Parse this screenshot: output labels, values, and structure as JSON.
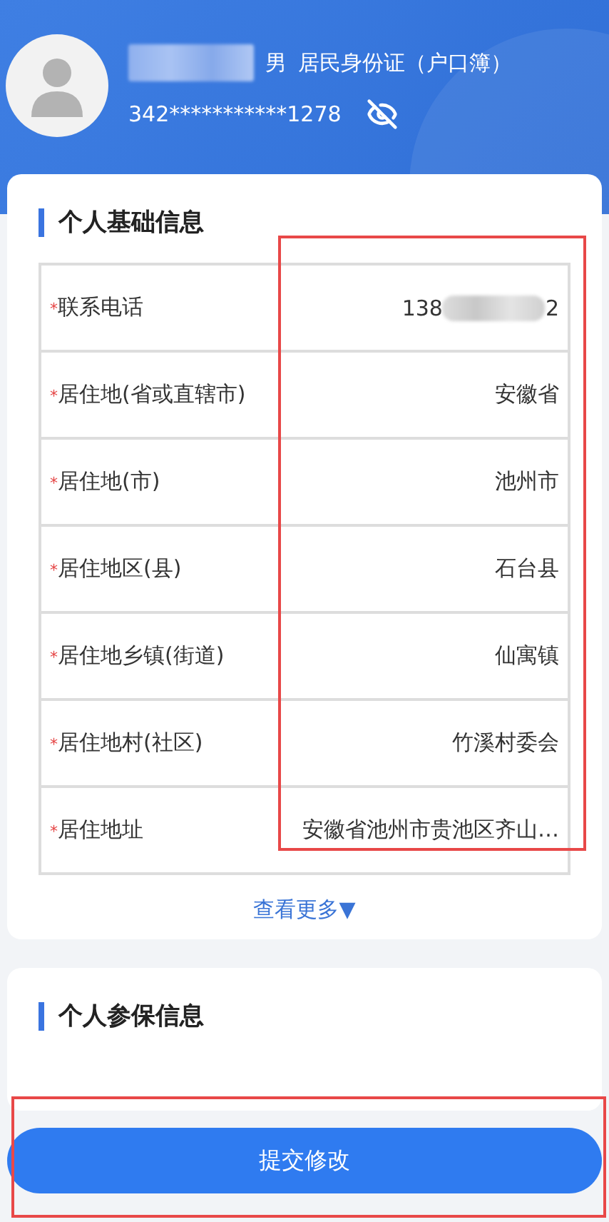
{
  "profile": {
    "gender": "男",
    "id_type": "居民身份证（户口簿）",
    "id_number": "342***********1278"
  },
  "basic_info": {
    "title": "个人基础信息",
    "rows": [
      {
        "marker": "*",
        "label": "联系电话",
        "value_start": "138",
        "value_end": "2",
        "redacted": true
      },
      {
        "marker": "*",
        "label": "居住地(省或直辖市)",
        "value": "安徽省"
      },
      {
        "marker": "*",
        "label": "居住地(市)",
        "value": "池州市"
      },
      {
        "marker": "*",
        "label": "居住地区(县)",
        "value": "石台县"
      },
      {
        "marker": "*",
        "label": "居住地乡镇(街道)",
        "value": "仙寓镇"
      },
      {
        "marker": "*",
        "label": "居住地村(社区)",
        "value": "竹溪村委会"
      },
      {
        "marker": "*",
        "label": "居住地址",
        "value": "安徽省池州市贵池区齐山…"
      }
    ],
    "more": "查看更多",
    "more_arrow": "▼"
  },
  "insurance_info": {
    "title": "个人参保信息"
  },
  "submit_button": "提交修改"
}
